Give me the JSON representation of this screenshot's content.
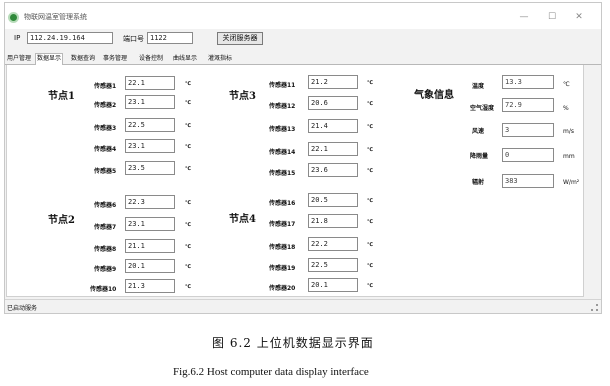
{
  "window": {
    "title": "物联网温室管理系统"
  },
  "window_controls": {
    "minimize": "—",
    "maximize": "☐",
    "close": "✕"
  },
  "connection": {
    "ip_label": "IP",
    "ip_value": "112.24.19.164",
    "port_label": "端口号",
    "port_value": "1122",
    "close_server_button": "关闭服务器"
  },
  "tabs": [
    "用户管理",
    "数据显示",
    "数据查询",
    "事务管理",
    "设备控制",
    "曲线显示",
    "灌溉指标"
  ],
  "nodes": [
    {
      "title": "节点1",
      "sensors": [
        {
          "label": "传感器1",
          "value": "22.1",
          "unit": "℃"
        },
        {
          "label": "传感器2",
          "value": "23.1",
          "unit": "℃"
        },
        {
          "label": "传感器3",
          "value": "22.5",
          "unit": "℃"
        },
        {
          "label": "传感器4",
          "value": "23.1",
          "unit": "℃"
        },
        {
          "label": "传感器5",
          "value": "23.5",
          "unit": "℃"
        }
      ]
    },
    {
      "title": "节点2",
      "sensors": [
        {
          "label": "传感器6",
          "value": "22.3",
          "unit": "℃"
        },
        {
          "label": "传感器7",
          "value": "23.1",
          "unit": "℃"
        },
        {
          "label": "传感器8",
          "value": "21.1",
          "unit": "℃"
        },
        {
          "label": "传感器9",
          "value": "20.1",
          "unit": "℃"
        },
        {
          "label": "传感器10",
          "value": "21.3",
          "unit": "℃"
        }
      ]
    },
    {
      "title": "节点3",
      "sensors": [
        {
          "label": "传感器11",
          "value": "21.2",
          "unit": "℃"
        },
        {
          "label": "传感器12",
          "value": "20.6",
          "unit": "℃"
        },
        {
          "label": "传感器13",
          "value": "21.4",
          "unit": "℃"
        },
        {
          "label": "传感器14",
          "value": "22.1",
          "unit": "℃"
        },
        {
          "label": "传感器15",
          "value": "23.6",
          "unit": "℃"
        }
      ]
    },
    {
      "title": "节点4",
      "sensors": [
        {
          "label": "传感器16",
          "value": "20.5",
          "unit": "℃"
        },
        {
          "label": "传感器17",
          "value": "21.8",
          "unit": "℃"
        },
        {
          "label": "传感器18",
          "value": "22.2",
          "unit": "℃"
        },
        {
          "label": "传感器19",
          "value": "22.5",
          "unit": "℃"
        },
        {
          "label": "传感器20",
          "value": "20.1",
          "unit": "℃"
        }
      ]
    }
  ],
  "weather": {
    "title": "气象信息",
    "items": [
      {
        "label": "温度",
        "value": "13.3",
        "unit": "℃"
      },
      {
        "label": "空气湿度",
        "value": "72.9",
        "unit": "%"
      },
      {
        "label": "风速",
        "value": "3",
        "unit": "m/s"
      },
      {
        "label": "降雨量",
        "value": "0",
        "unit": "mm"
      },
      {
        "label": "辐射",
        "value": "383",
        "unit": "W/m²"
      }
    ]
  },
  "status": {
    "text": "已启动服务"
  },
  "caption": {
    "zh": "图 6.2 上位机数据显示界面",
    "en": "Fig.6.2 Host computer data display interface"
  }
}
